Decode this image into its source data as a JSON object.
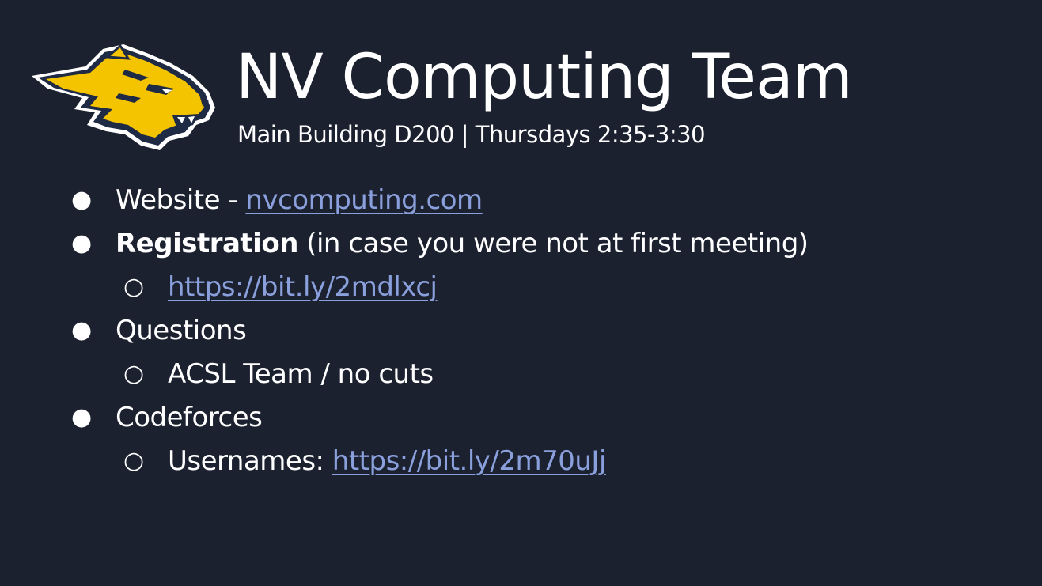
{
  "slide": {
    "title": "NV Computing Team",
    "subtitle": "Main Building D200 | Thursdays 2:35-3:30",
    "bullet_symbols": {
      "level1": "●",
      "level2": "○"
    },
    "items": [
      {
        "label": "Website - ",
        "link": "nvcomputing.com"
      },
      {
        "label_bold": "Registration",
        "label_rest": " (in case you were not at first meeting)"
      },
      {
        "link": "https://bit.ly/2mdlxcj"
      },
      {
        "label": "Questions"
      },
      {
        "label": "ACSL Team / no cuts"
      },
      {
        "label": "Codeforces"
      },
      {
        "label": "Usernames: ",
        "link": "https://bit.ly/2m70uJj"
      }
    ],
    "colors": {
      "background": "#1c2130",
      "text": "#ffffff",
      "link": "#8aa0dc",
      "logo_yellow": "#f5c400",
      "logo_navy": "#1f2a44"
    },
    "logo_icon": "wildcat-mascot-icon"
  }
}
